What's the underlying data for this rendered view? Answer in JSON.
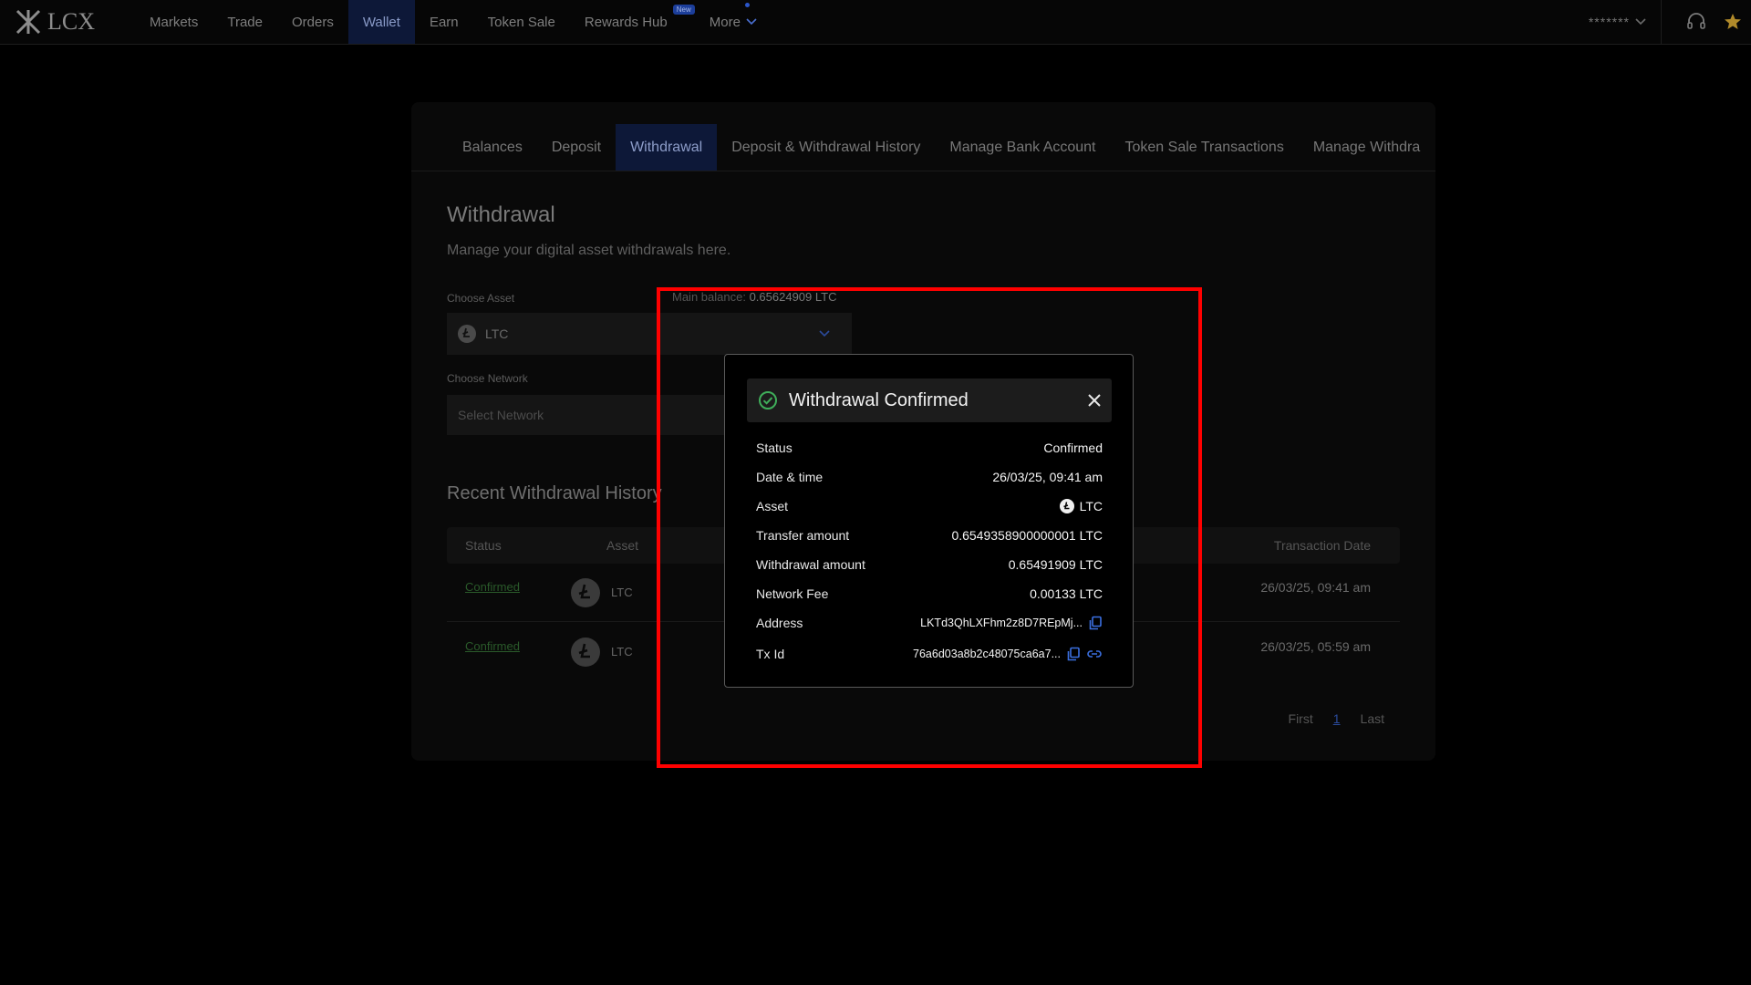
{
  "nav": {
    "logo_text": "LCX",
    "items": [
      "Markets",
      "Trade",
      "Orders",
      "Wallet",
      "Earn",
      "Token Sale",
      "Rewards Hub"
    ],
    "new_badge": "New",
    "more_label": "More",
    "user_masked": "*******"
  },
  "tabs": [
    "Balances",
    "Deposit",
    "Withdrawal",
    "Deposit & Withdrawal History",
    "Manage Bank Account",
    "Token Sale Transactions",
    "Manage Withdra"
  ],
  "page": {
    "title": "Withdrawal",
    "subtitle": "Manage your digital asset withdrawals here."
  },
  "form": {
    "asset_label": "Choose Asset",
    "asset_value": "LTC",
    "balance_label": "Main balance:",
    "balance_value": "0.65624909 LTC",
    "network_label": "Choose Network",
    "network_placeholder": "Select Network"
  },
  "history": {
    "title": "Recent Withdrawal History",
    "columns": {
      "status": "Status",
      "asset": "Asset",
      "date": "Transaction Date"
    },
    "rows": [
      {
        "status": "Confirmed",
        "asset": "LTC",
        "date": "26/03/25, 09:41 am"
      },
      {
        "status": "Confirmed",
        "asset": "LTC",
        "date": "26/03/25, 05:59 am"
      }
    ],
    "pager": {
      "first": "First",
      "current": "1",
      "last": "Last"
    }
  },
  "modal": {
    "title": "Withdrawal Confirmed",
    "rows": [
      {
        "label": "Status",
        "value": "Confirmed"
      },
      {
        "label": "Date & time",
        "value": "26/03/25, 09:41 am"
      },
      {
        "label": "Asset",
        "value": "LTC"
      },
      {
        "label": "Transfer amount",
        "value": "0.6549358900000001 LTC"
      },
      {
        "label": "Withdrawal amount",
        "value": "0.65491909 LTC"
      },
      {
        "label": "Network Fee",
        "value": "0.00133 LTC"
      },
      {
        "label": "Address",
        "value": "LKTd3QhLXFhm2z8D7REpMj..."
      },
      {
        "label": "Tx Id",
        "value": "76a6d03a8b2c48075ca6a7..."
      }
    ]
  },
  "colors": {
    "accent": "#2b56c9",
    "success": "#3fae5a",
    "highlight": "#ff0000"
  }
}
